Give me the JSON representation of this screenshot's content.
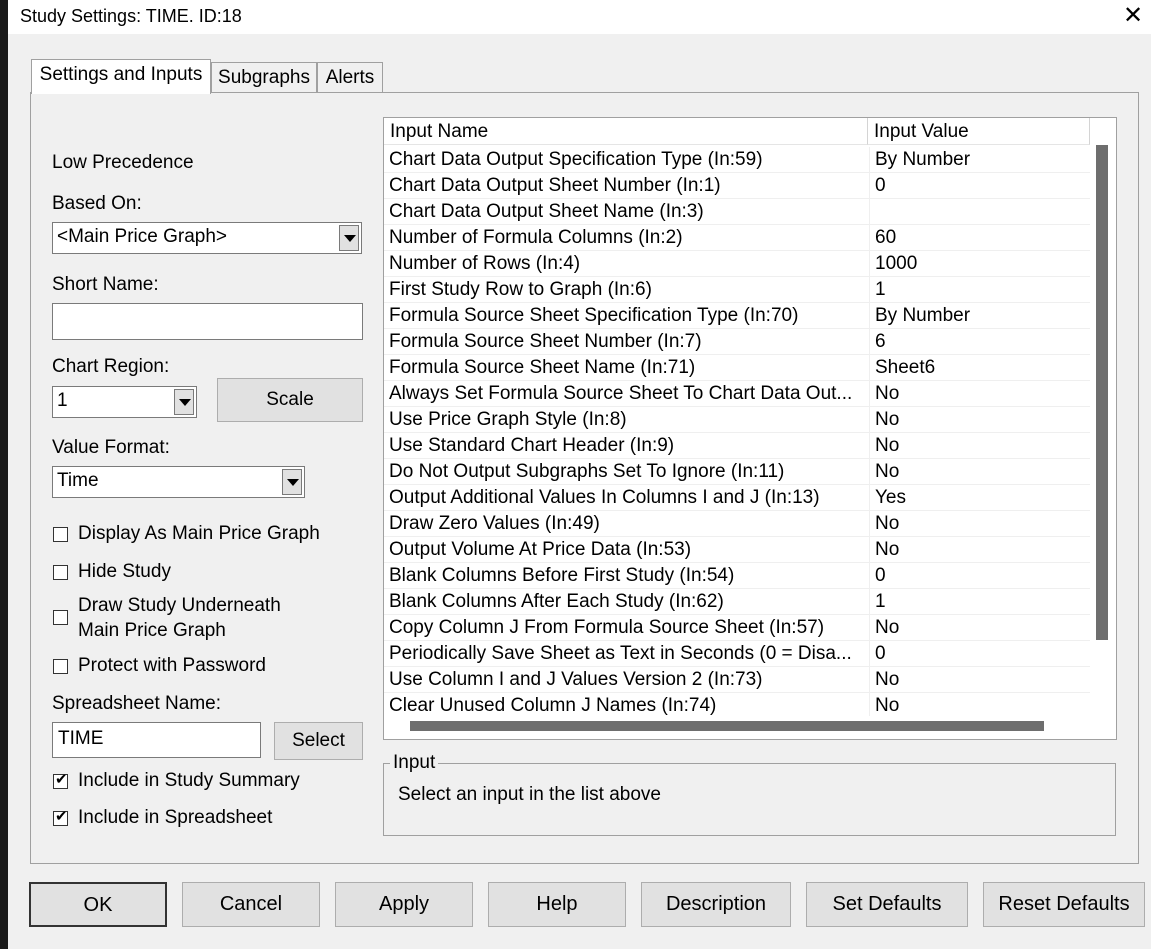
{
  "window": {
    "title": "Study Settings: TIME. ID:18",
    "close_glyph": "✕"
  },
  "tabs": [
    {
      "label": "Settings and Inputs",
      "active": true
    },
    {
      "label": "Subgraphs",
      "active": false
    },
    {
      "label": "Alerts",
      "active": false
    }
  ],
  "left": {
    "precedence": "Low Precedence",
    "based_on_label": "Based On:",
    "based_on_value": "<Main Price Graph>",
    "short_name_label": "Short Name:",
    "short_name_value": "",
    "chart_region_label": "Chart Region:",
    "chart_region_value": "1",
    "scale_button": "Scale",
    "value_format_label": "Value Format:",
    "value_format_value": "Time",
    "checkboxes": [
      {
        "label": "Display As Main Price Graph",
        "checked": false
      },
      {
        "label": "Hide Study",
        "checked": false
      },
      {
        "label_line1": "Draw Study Underneath",
        "label_line2": "Main Price Graph",
        "checked": false
      },
      {
        "label": "Protect with Password",
        "checked": false
      }
    ],
    "spreadsheet_name_label": "Spreadsheet Name:",
    "spreadsheet_name_value": "TIME",
    "select_button": "Select",
    "include_summary": {
      "label": "Include in Study Summary",
      "checked": true
    },
    "include_spreadsheet": {
      "label": "Include in Spreadsheet",
      "checked": true
    },
    "check_glyph": "✔"
  },
  "inputs_list": {
    "headers": [
      "Input Name",
      "Input Value"
    ],
    "rows": [
      {
        "name": "Chart Data Output Specification Type   (In:59)",
        "value": "By Number"
      },
      {
        "name": "Chart Data Output Sheet Number   (In:1)",
        "value": "0"
      },
      {
        "name": "Chart Data Output Sheet Name   (In:3)",
        "value": ""
      },
      {
        "name": "Number of Formula Columns   (In:2)",
        "value": "60"
      },
      {
        "name": "Number of Rows   (In:4)",
        "value": "1000"
      },
      {
        "name": "First Study Row to Graph   (In:6)",
        "value": "1"
      },
      {
        "name": "Formula Source Sheet Specification Type   (In:70)",
        "value": "By Number"
      },
      {
        "name": "Formula Source Sheet Number   (In:7)",
        "value": "6"
      },
      {
        "name": "Formula Source Sheet Name   (In:71)",
        "value": "Sheet6"
      },
      {
        "name": "Always Set Formula Source Sheet To Chart Data Out...",
        "value": "No"
      },
      {
        "name": "Use Price Graph Style   (In:8)",
        "value": "No"
      },
      {
        "name": "Use Standard Chart Header   (In:9)",
        "value": "No"
      },
      {
        "name": "Do Not Output Subgraphs Set To Ignore   (In:11)",
        "value": "No"
      },
      {
        "name": "Output Additional Values In Columns I and J   (In:13)",
        "value": "Yes"
      },
      {
        "name": "Draw Zero Values   (In:49)",
        "value": "No"
      },
      {
        "name": "Output Volume At Price Data   (In:53)",
        "value": "No"
      },
      {
        "name": "Blank Columns Before First Study   (In:54)",
        "value": "0"
      },
      {
        "name": "Blank Columns After Each Study   (In:62)",
        "value": "1"
      },
      {
        "name": "Copy Column J From Formula Source Sheet   (In:57)",
        "value": "No"
      },
      {
        "name": "Periodically Save Sheet as Text in Seconds (0 = Disa...",
        "value": "0"
      },
      {
        "name": "Use Column I and J Values Version 2   (In:73)",
        "value": "No"
      },
      {
        "name": "Clear Unused Column J Names   (In:74)",
        "value": "No"
      }
    ]
  },
  "input_group": {
    "label": "Input",
    "text": "Select an input in the list above"
  },
  "buttons": {
    "ok": "OK",
    "cancel": "Cancel",
    "apply": "Apply",
    "help": "Help",
    "description": "Description",
    "set_defaults": "Set Defaults",
    "reset_defaults": "Reset Defaults"
  }
}
